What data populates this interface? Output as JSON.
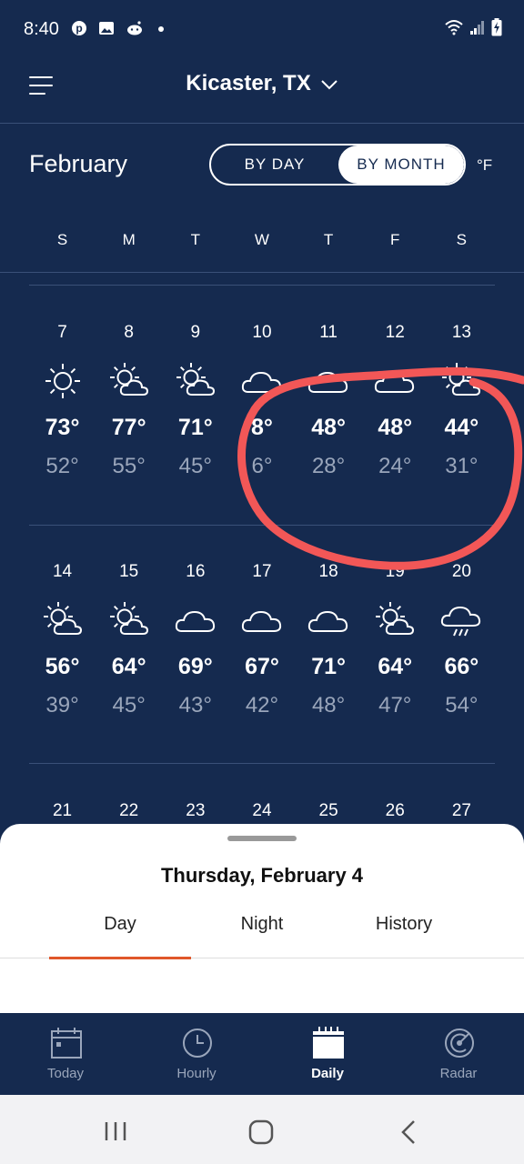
{
  "status_bar": {
    "time": "8:40",
    "left_icons": [
      "pinterest-icon",
      "gallery-icon",
      "reddit-icon",
      "dot-icon"
    ],
    "right_icons": [
      "wifi-icon",
      "signal-icon",
      "battery-charging-icon"
    ]
  },
  "header": {
    "location": "Kicaster, TX"
  },
  "month": {
    "title": "February",
    "toggle_by_day": "BY DAY",
    "toggle_by_month": "BY MONTH",
    "unit": "°F"
  },
  "weekdays": [
    "S",
    "M",
    "T",
    "W",
    "T",
    "F",
    "S"
  ],
  "weeks": [
    {
      "days": [
        {
          "date": "7",
          "icon": "sun-icon",
          "hi": "73°",
          "lo": "52°"
        },
        {
          "date": "8",
          "icon": "partly-cloudy-icon",
          "hi": "77°",
          "lo": "55°"
        },
        {
          "date": "9",
          "icon": "partly-cloudy-icon",
          "hi": "71°",
          "lo": "45°"
        },
        {
          "date": "10",
          "icon": "cloud-icon",
          "hi": "8°",
          "lo": "6°"
        },
        {
          "date": "11",
          "icon": "cloud-icon",
          "hi": "48°",
          "lo": "28°"
        },
        {
          "date": "12",
          "icon": "cloud-icon",
          "hi": "48°",
          "lo": "24°"
        },
        {
          "date": "13",
          "icon": "partly-cloudy-icon",
          "hi": "44°",
          "lo": "31°"
        }
      ]
    },
    {
      "days": [
        {
          "date": "14",
          "icon": "partly-cloudy-icon",
          "hi": "56°",
          "lo": "39°"
        },
        {
          "date": "15",
          "icon": "partly-cloudy-icon",
          "hi": "64°",
          "lo": "45°"
        },
        {
          "date": "16",
          "icon": "cloud-icon",
          "hi": "69°",
          "lo": "43°"
        },
        {
          "date": "17",
          "icon": "cloud-icon",
          "hi": "67°",
          "lo": "42°"
        },
        {
          "date": "18",
          "icon": "cloud-icon",
          "hi": "71°",
          "lo": "48°"
        },
        {
          "date": "19",
          "icon": "partly-cloudy-icon",
          "hi": "64°",
          "lo": "47°"
        },
        {
          "date": "20",
          "icon": "rain-icon",
          "hi": "66°",
          "lo": "54°"
        }
      ]
    },
    {
      "days": [
        {
          "date": "21"
        },
        {
          "date": "22"
        },
        {
          "date": "23"
        },
        {
          "date": "24"
        },
        {
          "date": "25"
        },
        {
          "date": "26"
        },
        {
          "date": "27"
        }
      ]
    }
  ],
  "sheet": {
    "title": "Thursday, February 4",
    "tabs": [
      "Day",
      "Night",
      "History"
    ],
    "active_tab": "Day"
  },
  "bottom_nav": [
    {
      "label": "Today",
      "icon": "calendar-today-icon"
    },
    {
      "label": "Hourly",
      "icon": "clock-icon"
    },
    {
      "label": "Daily",
      "icon": "calendar-daily-icon",
      "active": true
    },
    {
      "label": "Radar",
      "icon": "radar-icon"
    }
  ],
  "colors": {
    "background": "#152a4f",
    "accent": "#e0572a",
    "annotation": "#f25757",
    "muted_text": "#9aa6bb"
  }
}
